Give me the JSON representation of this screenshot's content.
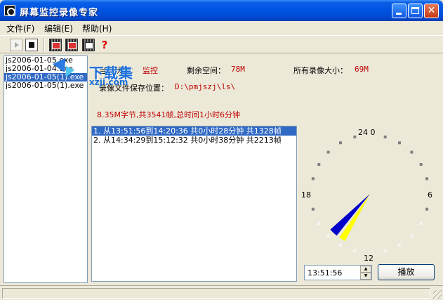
{
  "window": {
    "title": "屏幕监控录像专家"
  },
  "menu": [
    {
      "label": "文件(F)"
    },
    {
      "label": "编辑(E)"
    },
    {
      "label": "帮助(H)"
    }
  ],
  "toolbar": {
    "icons": [
      "play-icon",
      "stop-icon",
      "film-icon",
      "film-icon",
      "film-icon",
      "help-icon"
    ],
    "help_glyph": "?"
  },
  "files": [
    "js2006-01-05.exe",
    "js2006-01-04.exe",
    "js2006-01-05(1).exe",
    "js2006-01-05(1).exe"
  ],
  "selected_file_index": 2,
  "info": {
    "current_label": "当前状态：",
    "current_value": "监控",
    "space_label": "剩余空间：",
    "space_value": "78M",
    "all_label": "所有录像大小：",
    "all_value": "69M",
    "path_label": "录像文件保存位置：",
    "path_value": "D:\\pmjszj\\ls\\",
    "summary": "8.35M字节,共3541帧,总时间1小时6分钟"
  },
  "watermark": {
    "main": "下载集",
    "sub": "xzji.com"
  },
  "segments": [
    "1. 从13:51:56到14:20:36 共0小时28分钟 共1328帧",
    "2. 从14:34:29到15:12:32 共0小时38分钟 共2213帧"
  ],
  "selected_segment_index": 0,
  "clock": {
    "labels": {
      "top": "24 0",
      "right": "6",
      "bottom": "12",
      "left": "18"
    },
    "segments": [
      {
        "start_hour": 13.865,
        "end_hour": 14.343,
        "color": "#ffff00"
      },
      {
        "start_hour": 14.575,
        "end_hour": 15.209,
        "color": "#0000c8"
      }
    ]
  },
  "time_input": {
    "value": "13:51:56"
  },
  "play_button": {
    "label": "播放"
  },
  "colors": {
    "accent_red": "#c00000",
    "selection": "#316ac5",
    "title_blue": "#0054e3"
  }
}
